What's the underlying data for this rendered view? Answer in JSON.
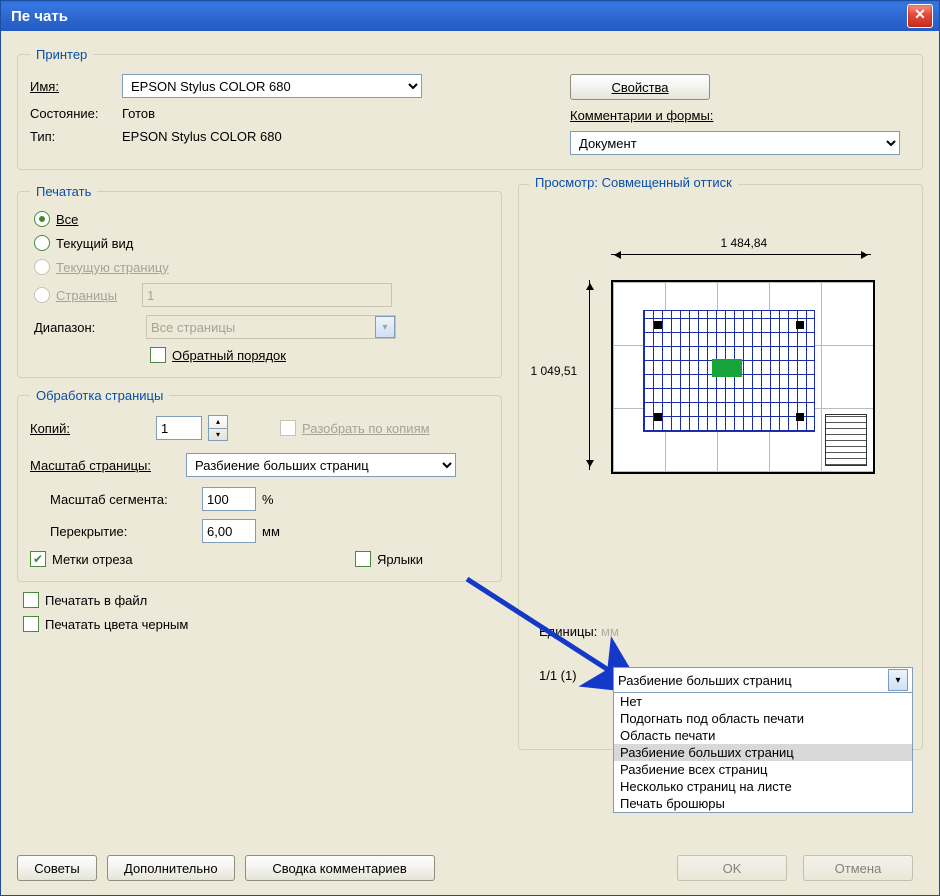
{
  "title": "Пе чать",
  "printer": {
    "legend": "Принтер",
    "name_label": "Имя:",
    "name_value": "EPSON Stylus COLOR 680",
    "properties_btn": "Свойства",
    "status_label": "Состояние:",
    "status_value": "Готов",
    "type_label": "Тип:",
    "type_value": "EPSON Stylus COLOR 680",
    "comments_label": "Комментарии и формы:",
    "comments_value": "Документ"
  },
  "range": {
    "legend": "Печатать",
    "all": "Все",
    "current_view": "Текущий вид",
    "current_page": "Текущую страницу",
    "pages": "Страницы",
    "pages_value": "1",
    "subset_label": "Диапазон:",
    "subset_value": "Все страницы",
    "reverse_label": "Обратный порядок"
  },
  "handling": {
    "legend": "Обработка страницы",
    "copies_label": "Копий:",
    "copies_value": "1",
    "collate_label": "Разобрать по копиям",
    "scale_label": "Масштаб страницы:",
    "scale_value": "Разбиение больших страниц",
    "tile_scale_label": "Масштаб сегмента:",
    "tile_scale_value": "100",
    "tile_scale_unit": "%",
    "overlap_label": "Перекрытие:",
    "overlap_value": "6,00",
    "overlap_unit": "мм",
    "cutmarks_label": "Метки отреза",
    "labels_label": "Ярлыки"
  },
  "misc": {
    "print_to_file": "Печатать в файл",
    "black_ink": "Печатать цвета черным"
  },
  "preview": {
    "title": "Просмотр: Совмещенный оттиск",
    "width": "1 484,84",
    "height": "1 049,51",
    "units_label": "Единицы:",
    "units_value": "мм",
    "page_info": "1/1 (1)"
  },
  "popup": {
    "selected": "Разбиение больших страниц",
    "items": [
      "Нет",
      "Подогнать под область печати",
      "Область печати",
      "Разбиение больших страниц",
      "Разбиение всех страниц",
      "Несколько страниц на листе",
      "Печать брошюры"
    ]
  },
  "buttons": {
    "tips": "Советы",
    "advanced": "Дополнительно",
    "summary": "Сводка комментариев",
    "ok": "OK",
    "cancel": "Отмена"
  }
}
